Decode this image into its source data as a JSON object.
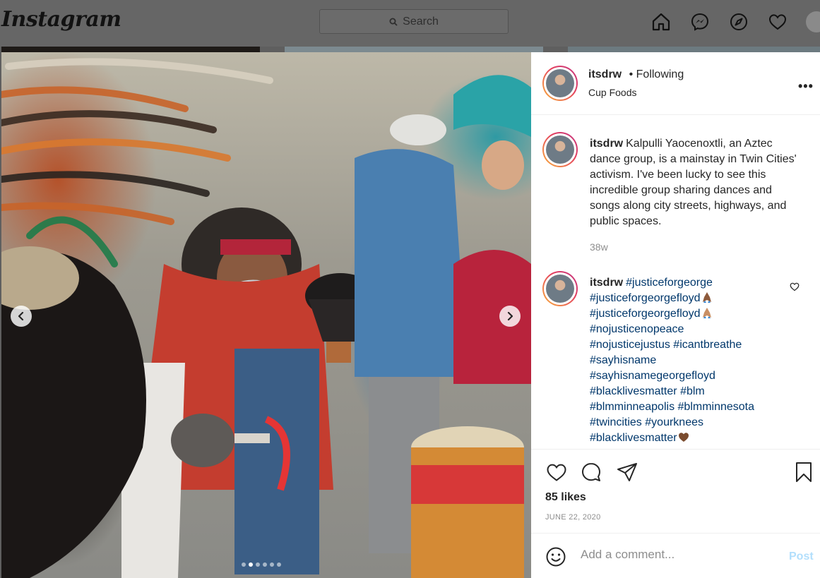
{
  "app": {
    "logo_text": "Instagram",
    "search_placeholder": "Search",
    "nav_icons": [
      "home-icon",
      "messenger-icon",
      "explore-icon",
      "activity-heart-icon",
      "profile-avatar"
    ]
  },
  "post": {
    "photo_alt": "Kalpulli Yaocenoxtli Aztec dance group with feathered headdresses, incense burner and drum",
    "carousel": {
      "total_dots": 6,
      "active_index": 1
    },
    "header": {
      "username": "itsdrw",
      "separator": "•",
      "follow_status": "Following",
      "location": "Cup Foods",
      "more_label": "•••"
    },
    "caption": {
      "username": "itsdrw",
      "text": "Kalpulli Yaocenoxtli, an Aztec dance group, is a mainstay in Twin Cities' activism. I've been lucky to see this incredible group sharing dances and songs along city streets, highways, and public spaces.",
      "time": "38w"
    },
    "comment": {
      "username": "itsdrw",
      "tags": [
        "#justiceforgeorge",
        "#justiceforgeorgefloyd",
        "#justiceforgeorgefloyd",
        "#nojusticenopeace",
        "#nojusticejustus",
        "#icantbreathe",
        "#sayhisname",
        "#sayhisnamegeorgefloyd",
        "#blacklivesmatter",
        "#blm",
        "#blmminneapolis",
        "#blmminnesota",
        "#twincities",
        "#yourknees",
        "#blacklivesmatter"
      ]
    },
    "likes": "85 likes",
    "date": "JUNE 22, 2020",
    "add_comment": {
      "placeholder": "Add a comment...",
      "post_label": "Post"
    }
  },
  "colors": {
    "link": "#00376b",
    "muted": "#8e8e8e",
    "post_disabled": "#b2dffc",
    "story_ring_start": "#f9b13a",
    "story_ring_end": "#c13584"
  }
}
